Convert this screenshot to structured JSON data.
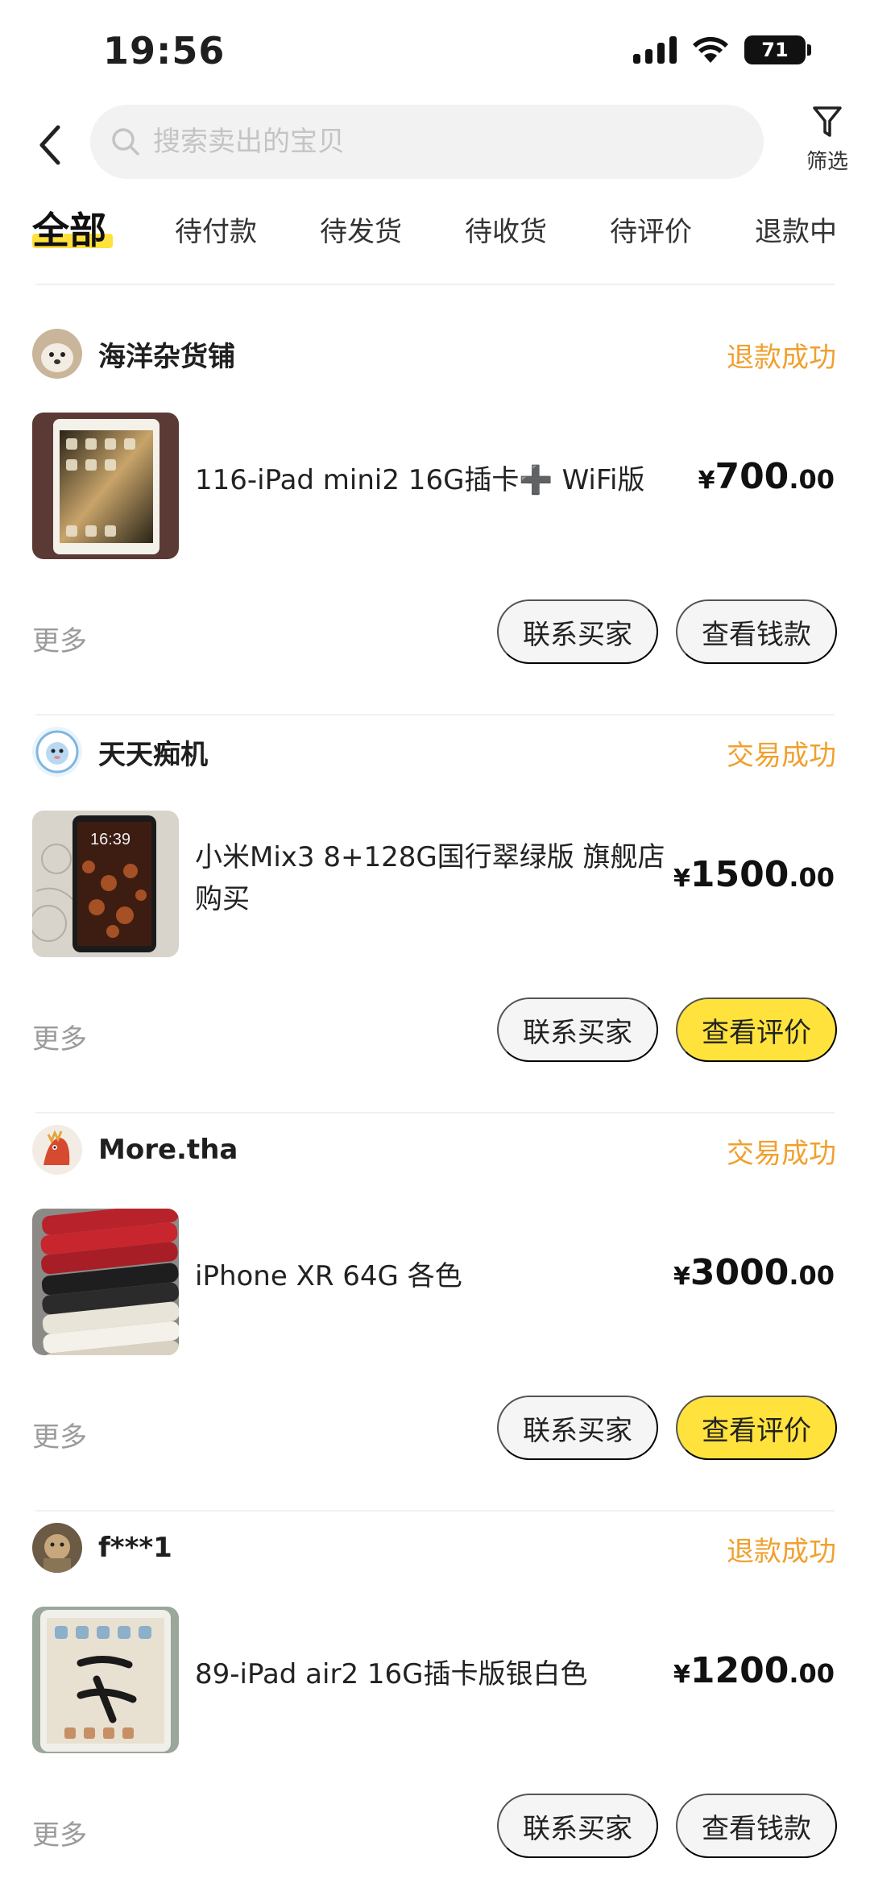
{
  "status_bar": {
    "time": "19:56",
    "battery": "71"
  },
  "search": {
    "placeholder": "搜索卖出的宝贝"
  },
  "filter": {
    "label": "筛选"
  },
  "tabs": [
    "全部",
    "待付款",
    "待发货",
    "待收货",
    "待评价",
    "退款中"
  ],
  "orders": [
    {
      "shop": "海洋杂货铺",
      "status": "退款成功",
      "title": "116-iPad mini2 16G插卡➕ WiFi版",
      "price_int": "700",
      "price_dec": ".00",
      "more": "更多",
      "contact_label": "联系买家",
      "action_label": "查看钱款"
    },
    {
      "shop": "天天痴机",
      "status": "交易成功",
      "title": "小米Mix3 8+128G国行翠绿版  旗舰店购买",
      "price_int": "1500",
      "price_dec": ".00",
      "more": "更多",
      "contact_label": "联系买家",
      "action_label": "查看评价"
    },
    {
      "shop": "More.tha",
      "status": "交易成功",
      "title": "iPhone XR 64G 各色",
      "price_int": "3000",
      "price_dec": ".00",
      "more": "更多",
      "contact_label": "联系买家",
      "action_label": "查看评价"
    },
    {
      "shop": "f***1",
      "status": "退款成功",
      "title": "89-iPad air2 16G插卡版银白色",
      "price_int": "1200",
      "price_dec": ".00",
      "more": "更多",
      "contact_label": "联系买家",
      "action_label": "查看钱款"
    }
  ],
  "currency_symbol": "¥",
  "colors": {
    "accent_yellow": "#ffe33c",
    "status_orange": "#f0a02f"
  }
}
